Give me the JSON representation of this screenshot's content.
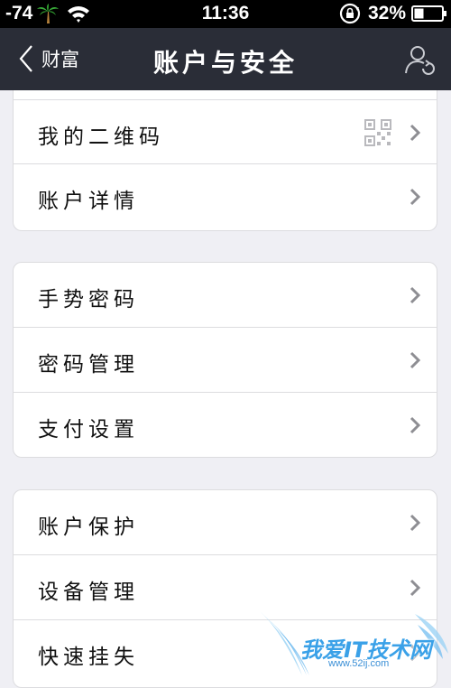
{
  "status_bar": {
    "signal": "-74",
    "time": "11:36",
    "battery": "32%",
    "icons": [
      "palm-tree-icon",
      "wifi-icon",
      "rotation-lock-icon",
      "battery-icon"
    ]
  },
  "nav": {
    "back_label": "财富",
    "title": "账户与安全",
    "right_icon": "user-sync-icon"
  },
  "groups": [
    {
      "items": [
        {
          "label": "我的二维码",
          "icon": "qr-code-icon"
        },
        {
          "label": "账户详情"
        }
      ]
    },
    {
      "items": [
        {
          "label": "手势密码"
        },
        {
          "label": "密码管理"
        },
        {
          "label": "支付设置"
        }
      ]
    },
    {
      "items": [
        {
          "label": "账户保护"
        },
        {
          "label": "设备管理"
        },
        {
          "label": "快速挂失"
        }
      ]
    }
  ],
  "watermark": {
    "text": "我爱IT技术网",
    "url": "www.52ij.com"
  },
  "colors": {
    "nav_bg": "#2a2d37",
    "page_bg": "#efeff4",
    "chevron": "#8e8e93",
    "watermark": "#3aa1e8"
  }
}
